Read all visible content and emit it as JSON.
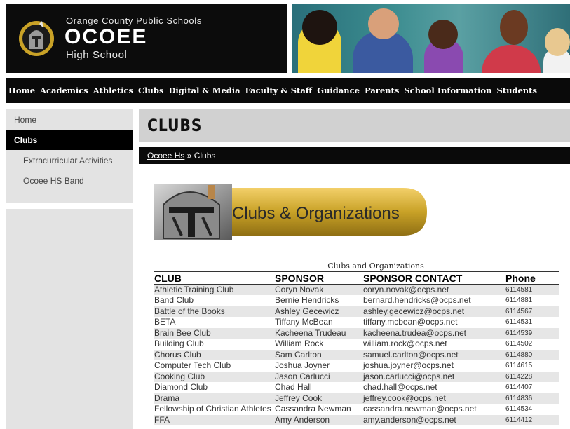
{
  "header": {
    "district": "Orange County Public Schools",
    "school": "OCOEE",
    "school_sub": "High School"
  },
  "nav": {
    "items": [
      {
        "label": "Home"
      },
      {
        "label": "Academics"
      },
      {
        "label": "Athletics"
      },
      {
        "label": "Clubs"
      },
      {
        "label": "Digital & Media"
      },
      {
        "label": "Faculty & Staff"
      },
      {
        "label": "Guidance"
      },
      {
        "label": "Parents"
      },
      {
        "label": "School Information"
      },
      {
        "label": "Students"
      }
    ]
  },
  "sidebar": {
    "items": [
      {
        "label": "Home"
      },
      {
        "label": "Clubs"
      },
      {
        "label": "Extracurricular Activities"
      },
      {
        "label": "Ocoee HS Band"
      }
    ]
  },
  "page": {
    "title": "CLUBS",
    "breadcrumb_link": "Ocoee Hs",
    "breadcrumb_sep": " » ",
    "breadcrumb_current": "Clubs",
    "banner_text": "Clubs & Organizations"
  },
  "table": {
    "caption": "Clubs and Organizations",
    "headers": [
      "CLUB",
      "SPONSOR",
      "SPONSOR CONTACT",
      "Phone"
    ],
    "rows": [
      [
        "Athletic Training Club",
        "Coryn Novak",
        "coryn.novak@ocps.net",
        "6114581"
      ],
      [
        "Band Club",
        "Bernie Hendricks",
        "bernard.hendricks@ocps.net",
        "6114881"
      ],
      [
        "Battle of the Books",
        "Ashley Gecewicz",
        "ashley.gecewicz@ocps.net",
        "6114567"
      ],
      [
        "BETA",
        "Tiffany McBean",
        "tiffany.mcbean@ocps.net",
        "6114531"
      ],
      [
        "Brain Bee Club",
        "Kacheena Trudeau",
        "kacheena.trudea@ocps.net",
        "6114539"
      ],
      [
        "Building Club",
        "William Rock",
        "william.rock@ocps.net",
        "6114502"
      ],
      [
        "Chorus Club",
        "Sam Carlton",
        "samuel.carlton@ocps.net",
        "6114880"
      ],
      [
        "Computer Tech Club",
        "Joshua Joyner",
        "joshua.joyner@ocps.net",
        "6114615"
      ],
      [
        "Cooking Club",
        "Jason Carlucci",
        "jason.carlucci@ocps.net",
        "6114228"
      ],
      [
        "Diamond Club",
        "Chad Hall",
        "chad.hall@ocps.net",
        "6114407"
      ],
      [
        "Drama",
        "Jeffrey Cook",
        "jeffrey.cook@ocps.net",
        "6114836"
      ],
      [
        "Fellowship of Christian Athletes",
        "Cassandra Newman",
        "cassandra.newman@ocps.net",
        "6114534"
      ],
      [
        "FFA",
        "Amy Anderson",
        "amy.anderson@ocps.net",
        "6114412"
      ]
    ]
  },
  "colors": {
    "nav_bg": "#0a0a0a",
    "title_bg": "#d1d1d1",
    "sidebar_bg": "#e3e3e3",
    "banner_gold": "#c9a227"
  }
}
